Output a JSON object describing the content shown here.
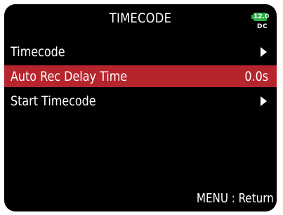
{
  "header": {
    "title": "TIMECODE",
    "battery_level": "12.0",
    "power_source": "DC",
    "battery_color": "#2fae45"
  },
  "menu": {
    "items": [
      {
        "label": "Timecode",
        "value": "",
        "icon": "chevron-right-icon",
        "selected": false
      },
      {
        "label": "Auto Rec Delay Time",
        "value": "0.0s",
        "icon": "",
        "selected": true
      },
      {
        "label": "Start Timecode",
        "value": "",
        "icon": "chevron-right-icon",
        "selected": false
      }
    ],
    "selected_color": "#b6242c"
  },
  "footer": {
    "hint": "MENU : Return"
  }
}
